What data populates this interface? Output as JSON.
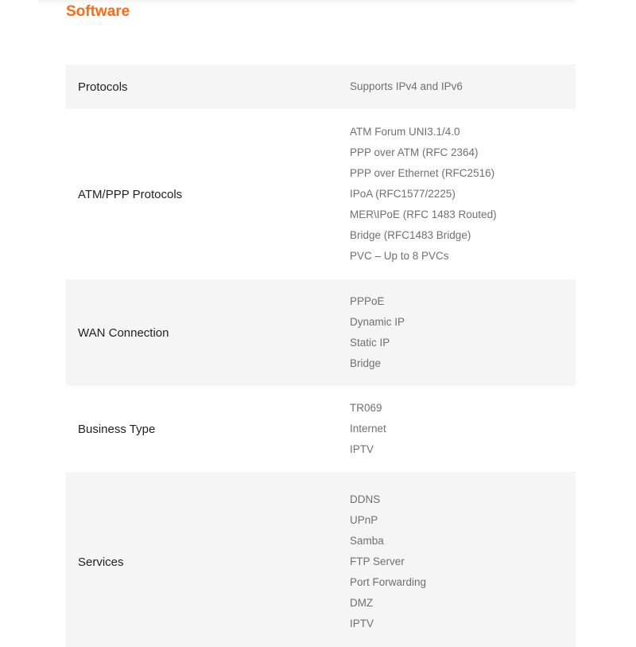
{
  "section": {
    "title": "Software"
  },
  "specs": [
    {
      "label": "Protocols",
      "values": [
        "Supports IPv4 and IPv6"
      ]
    },
    {
      "label": "ATM/PPP Protocols",
      "values": [
        "ATM Forum UNI3.1/4.0",
        "PPP over ATM (RFC 2364)",
        "PPP over Ethernet (RFC2516)",
        "IPoA (RFC1577/2225)",
        "MER\\IPoE (RFC 1483 Routed)",
        "Bridge (RFC1483 Bridge)",
        "PVC – Up to 8 PVCs"
      ]
    },
    {
      "label": "WAN Connection",
      "values": [
        "PPPoE",
        "Dynamic IP",
        "Static IP",
        "Bridge"
      ]
    },
    {
      "label": "Business Type",
      "values": [
        "TR069",
        "Internet",
        "IPTV"
      ]
    },
    {
      "label": "Services",
      "values": [
        "DDNS",
        "UPnP",
        "Samba",
        "FTP Server",
        "Port Forwarding",
        "DMZ",
        "IPTV"
      ]
    }
  ],
  "colors": {
    "accent": "#ff6a13",
    "row_shade": "#f5f5f5",
    "label_text": "#222222",
    "value_text": "#707070"
  }
}
